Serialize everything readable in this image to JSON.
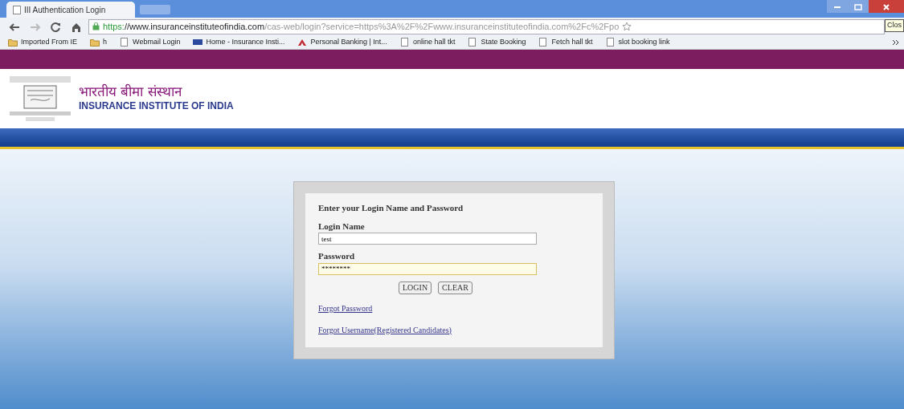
{
  "browser": {
    "tab": {
      "title": "III Authentication Login",
      "selected": true
    },
    "url": {
      "scheme": "https:",
      "host": "//www.insuranceinstituteofindia.com",
      "rest": "/cas-web/login?service=https%3A%2F%2Fwww.insuranceinstituteofindia.com%2Fc%2Fpo"
    },
    "tooltip": "Clos",
    "bookmarks": [
      {
        "label": "Imported From IE",
        "kind": "folder"
      },
      {
        "label": "h",
        "kind": "folder"
      },
      {
        "label": "Webmail Login",
        "kind": "page"
      },
      {
        "label": "Home - Insurance Insti...",
        "kind": "site"
      },
      {
        "label": "Personal Banking | Int...",
        "kind": "bank"
      },
      {
        "label": "online hall tkt",
        "kind": "page"
      },
      {
        "label": "State Booking",
        "kind": "page"
      },
      {
        "label": "Fetch hall tkt",
        "kind": "page"
      },
      {
        "label": "slot booking link",
        "kind": "page"
      }
    ]
  },
  "header": {
    "name_hindi": "भारतीय बीमा संस्थान",
    "name_english": "INSURANCE INSTITUTE OF INDIA"
  },
  "login": {
    "heading": "Enter your Login Name and Password",
    "fields": [
      {
        "label": "Login Name",
        "value": "test",
        "focused": false
      },
      {
        "label": "Password",
        "value": "********",
        "focused": true
      }
    ],
    "buttons": [
      "LOGIN",
      "CLEAR"
    ],
    "links": [
      "Forgot Password",
      "Forgot Username(Registered Candidates)"
    ]
  }
}
